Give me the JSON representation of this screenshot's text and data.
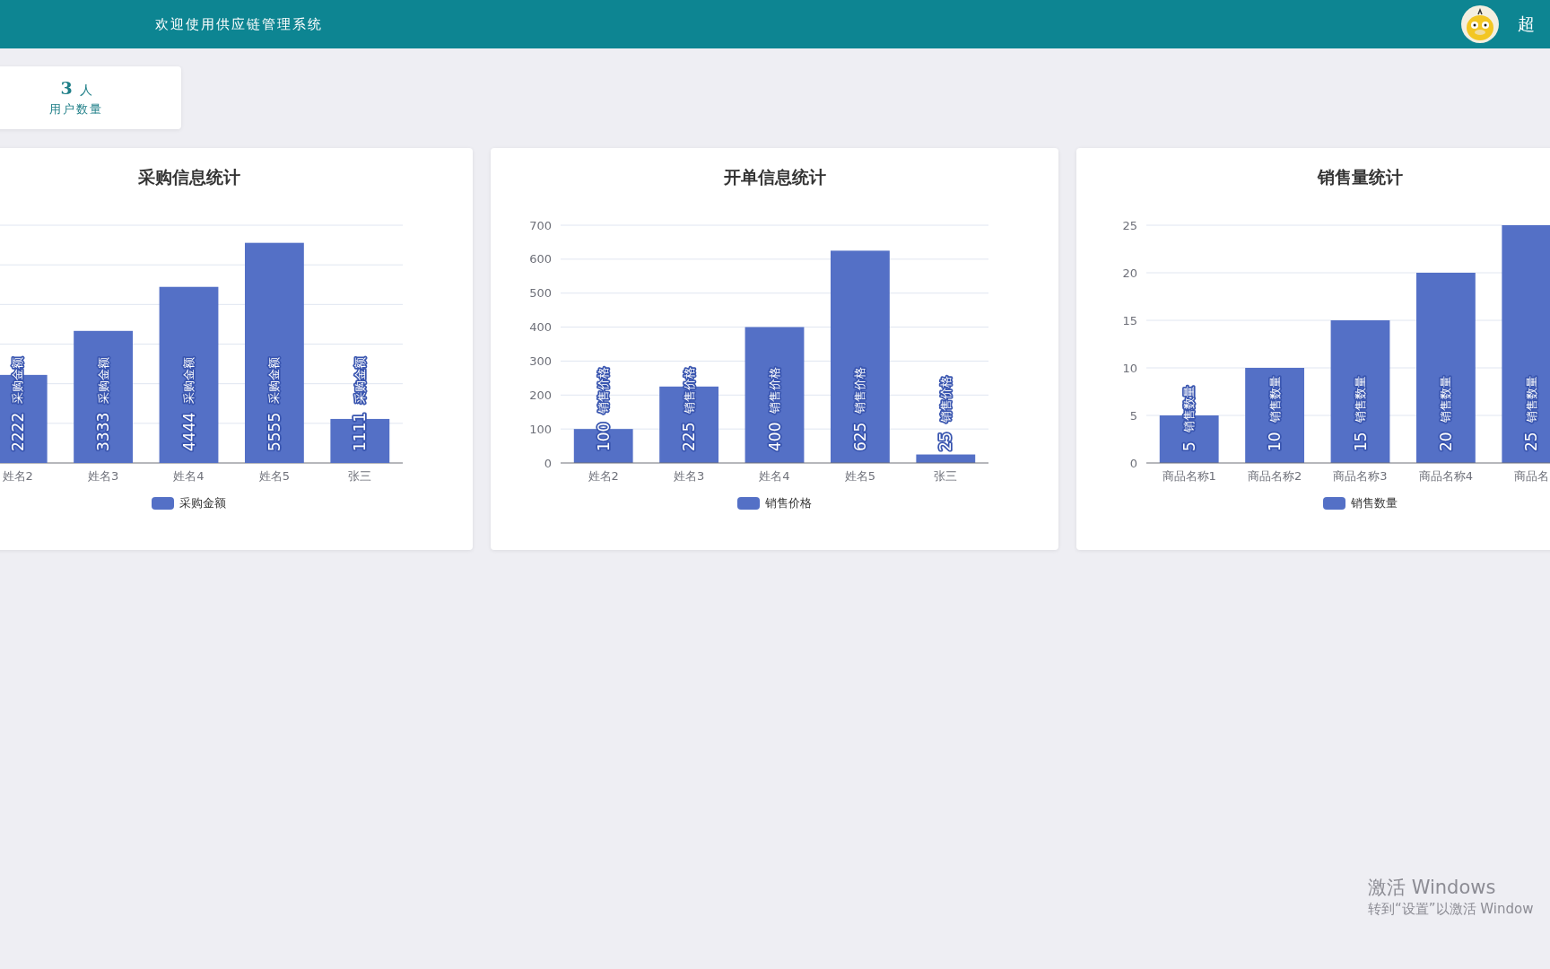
{
  "header": {
    "title": "欢迎使用供应链管理系统",
    "user_name": "超"
  },
  "stats": [
    {
      "value": "3",
      "unit": "人",
      "label": "用户数量"
    }
  ],
  "charts": [
    {
      "title": "采购信息统计",
      "chart_data": {
        "type": "bar",
        "categories": [
          "姓名2",
          "姓名3",
          "姓名4",
          "姓名5",
          "张三"
        ],
        "series": [
          {
            "name": "采购金额",
            "color": "#5470c6",
            "values": [
              2222,
              3333,
              4444,
              5555,
              1111
            ]
          }
        ],
        "grid": true,
        "data_labels": true,
        "annotations": [
          "采购金额",
          "采购金额",
          "采购金额",
          "采购金额",
          "采购金额"
        ]
      }
    },
    {
      "title": "开单信息统计",
      "chart_data": {
        "type": "bar",
        "categories": [
          "姓名2",
          "姓名3",
          "姓名4",
          "姓名5",
          "张三"
        ],
        "series": [
          {
            "name": "销售价格",
            "color": "#5470c6",
            "values": [
              100,
              225,
              400,
              625,
              25
            ]
          }
        ],
        "ylim": [
          0,
          700
        ],
        "yticks": [
          0,
          100,
          200,
          300,
          400,
          500,
          600,
          700
        ],
        "grid": true,
        "data_labels": true,
        "annotations": [
          "销售价格",
          "销售价格",
          "销售价格",
          "销售价格",
          "销售价格"
        ]
      }
    },
    {
      "title": "销售量统计",
      "chart_data": {
        "type": "bar",
        "categories": [
          "商品名称1",
          "商品名称2",
          "商品名称3",
          "商品名称4",
          "商品名"
        ],
        "series": [
          {
            "name": "销售数量",
            "color": "#5470c6",
            "values": [
              5,
              10,
              15,
              20,
              25
            ]
          }
        ],
        "ylim": [
          0,
          25
        ],
        "yticks": [
          0,
          5,
          10,
          15,
          20,
          25
        ],
        "grid": true,
        "data_labels": true,
        "annotations": [
          "销售数量",
          "销售数量",
          "销售数量",
          "销售数量",
          "销售数量"
        ]
      }
    }
  ],
  "os_notice": {
    "title": "激活 Windows",
    "hint": "转到“设置”以激活 Window"
  }
}
